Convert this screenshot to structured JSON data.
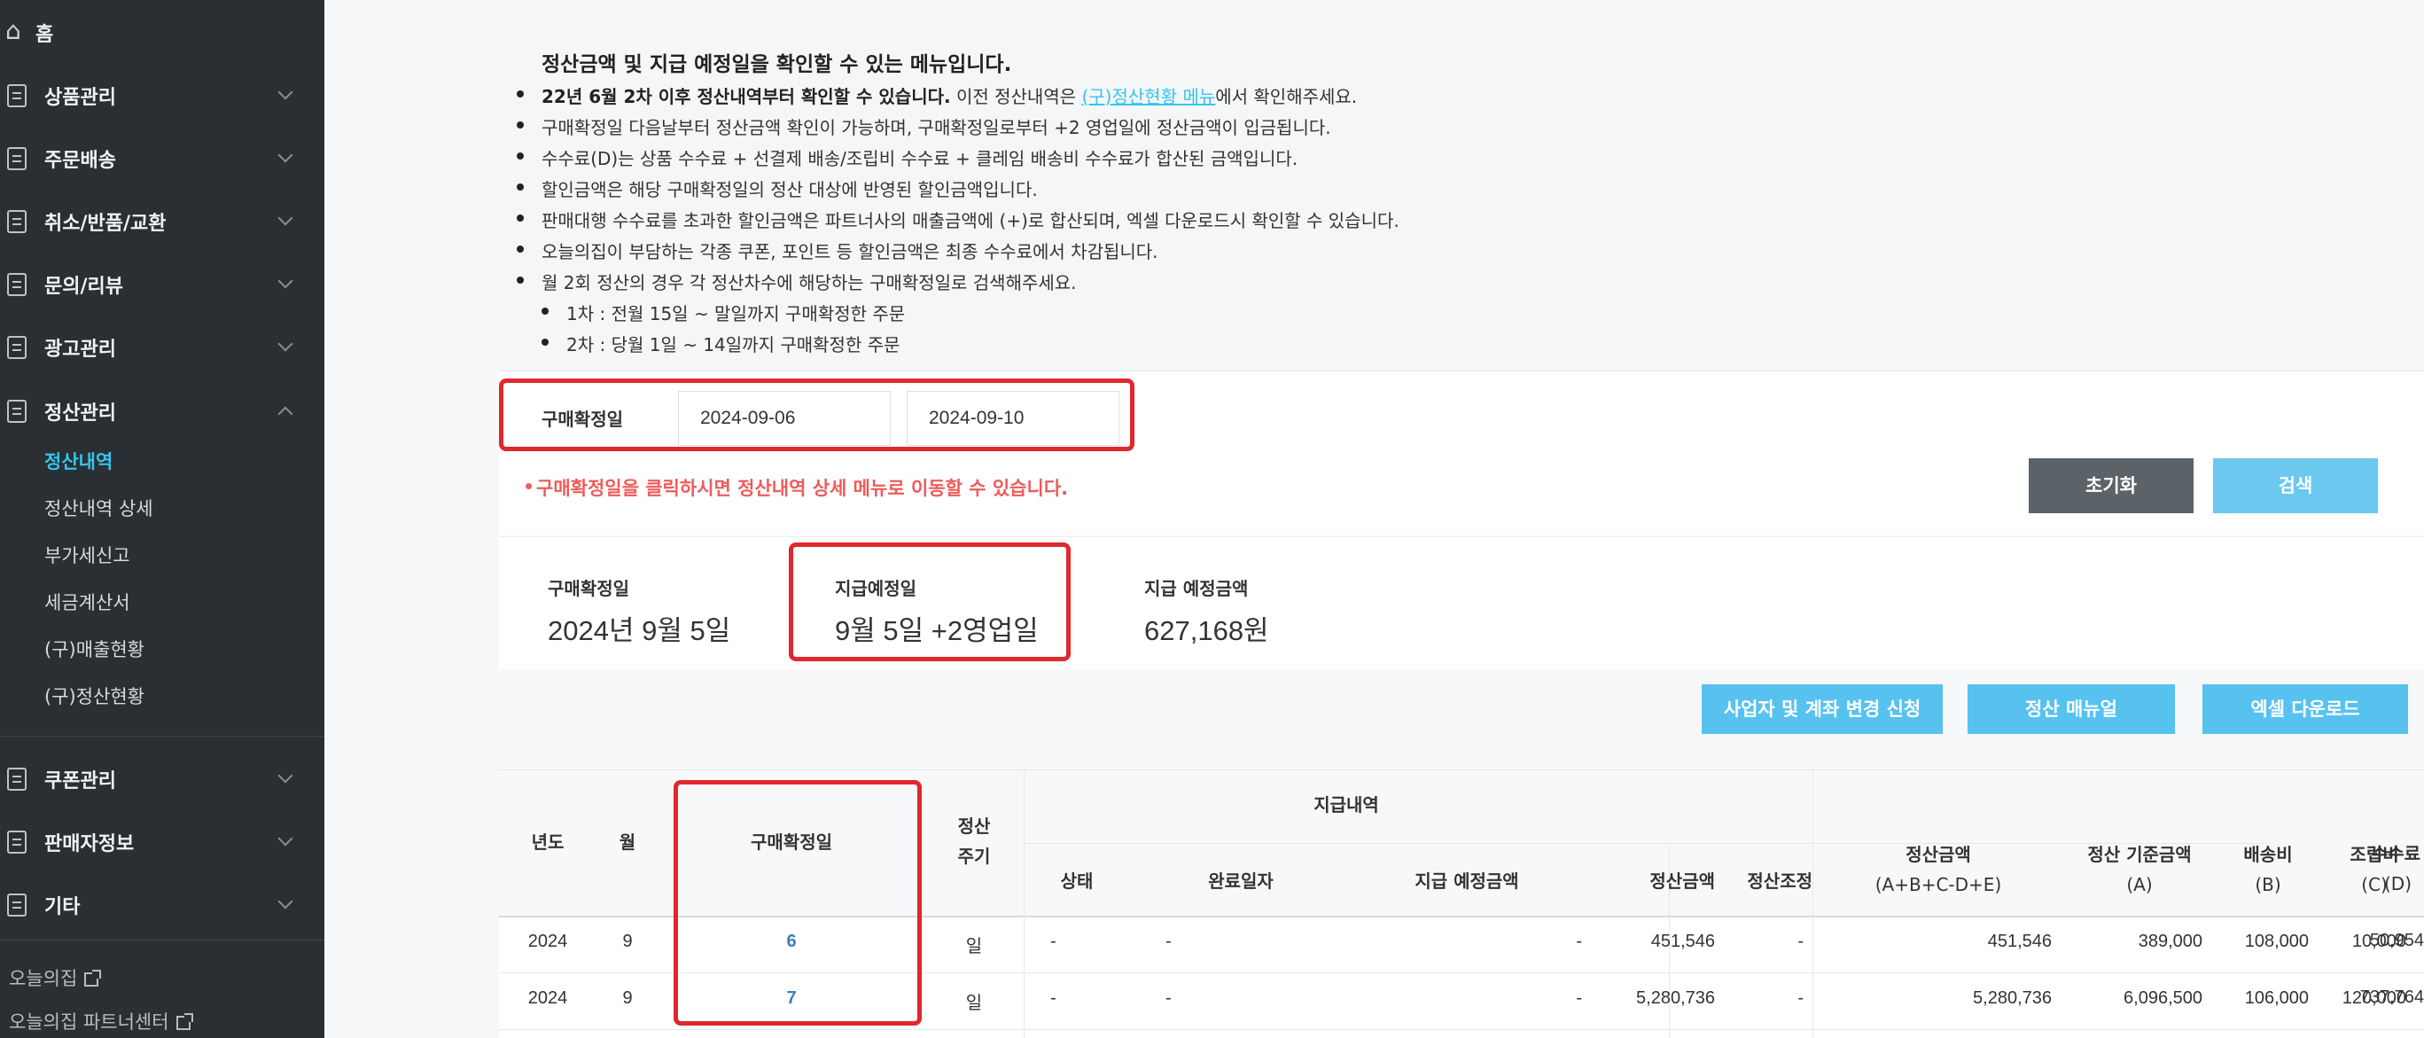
{
  "sidebar": {
    "home": "홈",
    "items": [
      {
        "label": "상품관리"
      },
      {
        "label": "주문배송"
      },
      {
        "label": "취소/반품/교환"
      },
      {
        "label": "문의/리뷰"
      },
      {
        "label": "광고관리"
      },
      {
        "label": "정산관리"
      },
      {
        "label": "쿠폰관리"
      },
      {
        "label": "판매자정보"
      },
      {
        "label": "기타"
      }
    ],
    "sub_items": [
      "정산내역",
      "정산내역 상세",
      "부가세신고",
      "세금계산서",
      "(구)매출현황",
      "(구)정산현황"
    ],
    "footer_links": [
      "오늘의집",
      "오늘의집 파트너센터"
    ]
  },
  "notice": {
    "title": "정산금액 및 지급 예정일을 확인할 수 있는 메뉴입니다.",
    "line1_bold": "22년 6월 2차 이후 정산내역부터 확인할 수 있습니다.",
    "line1_pre": " 이전 정산내역은 ",
    "line1_link": "(구)정산현황 메뉴",
    "line1_post": "에서 확인해주세요.",
    "lines": [
      "구매확정일 다음날부터 정산금액 확인이 가능하며, 구매확정일로부터 +2 영업일에 정산금액이 입금됩니다.",
      "수수료(D)는 상품 수수료 + 선결제 배송/조립비 수수료 + 클레임 배송비 수수료가 합산된 금액입니다.",
      "할인금액은 해당 구매확정일의 정산 대상에 반영된 할인금액입니다.",
      "판매대행 수수료를 초과한 할인금액은 파트너사의 매출금액에 (+)로 합산되며, 엑셀 다운로드시 확인할 수 있습니다.",
      "오늘의집이 부담하는 각종 쿠폰, 포인트 등 할인금액은 최종 수수료에서 차감됩니다.",
      "월 2회 정산의 경우 각 정산차수에 해당하는 구매확정일로 검색해주세요."
    ],
    "sub_lines": [
      "1차 : 전월 15일 ~ 말일까지 구매확정한 주문",
      "2차 : 당월 1일 ~ 14일까지 구매확정한 주문"
    ]
  },
  "search": {
    "label": "구매확정일",
    "start_date": "2024-09-06",
    "end_date": "2024-09-10",
    "warning": "구매확정일을 클릭하시면 정산내역 상세 메뉴로 이동할 수 있습니다.",
    "reset_label": "초기화",
    "search_label": "검색"
  },
  "summary": {
    "confirm_label": "구매확정일",
    "confirm_value": "2024년 9월 5일",
    "pay_date_label": "지급예정일",
    "pay_date_value": "9월 5일 +2영업일",
    "pay_amount_label": "지급 예정금액",
    "pay_amount_value": "627,168원"
  },
  "actions": {
    "change_request": "사업자 및 계좌 변경 신청",
    "manual": "정산 매뉴얼",
    "excel": "엑셀 다운로드"
  },
  "table": {
    "headers": {
      "year": "년도",
      "month": "월",
      "confirm_date": "구매확정일",
      "cycle_1": "정산",
      "cycle_2": "주기",
      "payment_group": "지급내역",
      "status": "상태",
      "done_date": "완료일자",
      "expected": "지급 예정금액",
      "settle_amount": "정산금액",
      "adjust": "정산조정",
      "total_1": "정산금액",
      "total_2": "(A+B+C-D+E)",
      "base_1": "정산 기준금액",
      "base_2": "(A)",
      "ship_1": "배송비",
      "ship_2": "(B)",
      "assembly_1": "조립비",
      "assembly_2": "(C)",
      "fee_1": "수수료",
      "fee_2": "(D)"
    },
    "rows": [
      {
        "year": "2024",
        "month": "9",
        "day": "6",
        "cycle": "일",
        "status": "-",
        "done": "-",
        "expected": "-",
        "settle": "451,546",
        "adjust": "-",
        "total": "451,546",
        "base": "389,000",
        "ship": "108,000",
        "assembly": "10,000",
        "fee": "50,954"
      },
      {
        "year": "2024",
        "month": "9",
        "day": "7",
        "cycle": "일",
        "status": "-",
        "done": "-",
        "expected": "-",
        "settle": "5,280,736",
        "adjust": "-",
        "total": "5,280,736",
        "base": "6,096,500",
        "ship": "106,000",
        "assembly": "120,000",
        "fee": "737,764"
      }
    ]
  },
  "colors": {
    "sidebar_bg": "#2a2f33",
    "accent": "#35c5f0",
    "highlight": "#e0282e",
    "warning": "#ef5b5b"
  }
}
